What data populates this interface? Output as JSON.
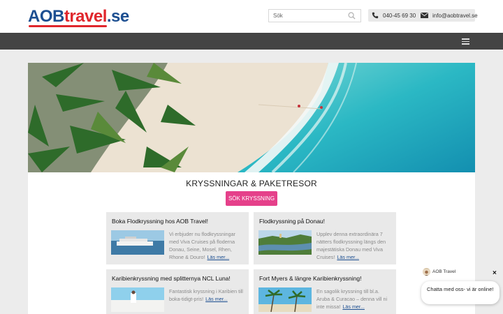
{
  "header": {
    "logo": {
      "part1": "AOB",
      "part2": "travel",
      "part3": ".se"
    },
    "search": {
      "placeholder": "Sök"
    },
    "contact": {
      "phone": "040-45 69 30",
      "email": "info@aobtravel.se"
    }
  },
  "navbar": {
    "menu_icon": "hamburger-menu-icon"
  },
  "main": {
    "hero_alt": "beach-palms-aerial",
    "section_title": "KRYSSNINGAR & PAKETRESOR",
    "cta_label": "SÖK KRYSSNING",
    "cards": [
      {
        "title": "Boka Flodkryssning hos AOB Travel!",
        "text": "Vi erbjuder nu flodkryssningar med Viva Cruises på floderna Donau, Seine, Mosel, Rhen, Rhone & Douro!",
        "link": "Läs mer..."
      },
      {
        "title": "Flodkryssning på Donau!",
        "text": "Upplev denna extraordinära 7 nätters flodkryssning längs den majestätiska Donau med Viva Cruises!",
        "link": "Läs mer..."
      },
      {
        "title": "Karibienkryssning med splitternya NCL Luna!",
        "text": "Fantastisk kryssning i Karibien till boka-tidigt-pris!",
        "link": "Läs mer..."
      },
      {
        "title": "Fort Myers & längre Karibienkryssning!",
        "text": "En sagolik kryssning till bl.a. Aruba & Curacao – denna vill ni inte missa!",
        "link": "Läs mer..."
      }
    ]
  },
  "chat": {
    "agent_name": "AOB Travel",
    "message": "Chatta med oss- vi är online!",
    "close_label": "×"
  },
  "colors": {
    "brand_blue": "#1d4f91",
    "brand_red": "#e0262c",
    "cta_pink": "#e5408a",
    "navbar": "#444444"
  }
}
